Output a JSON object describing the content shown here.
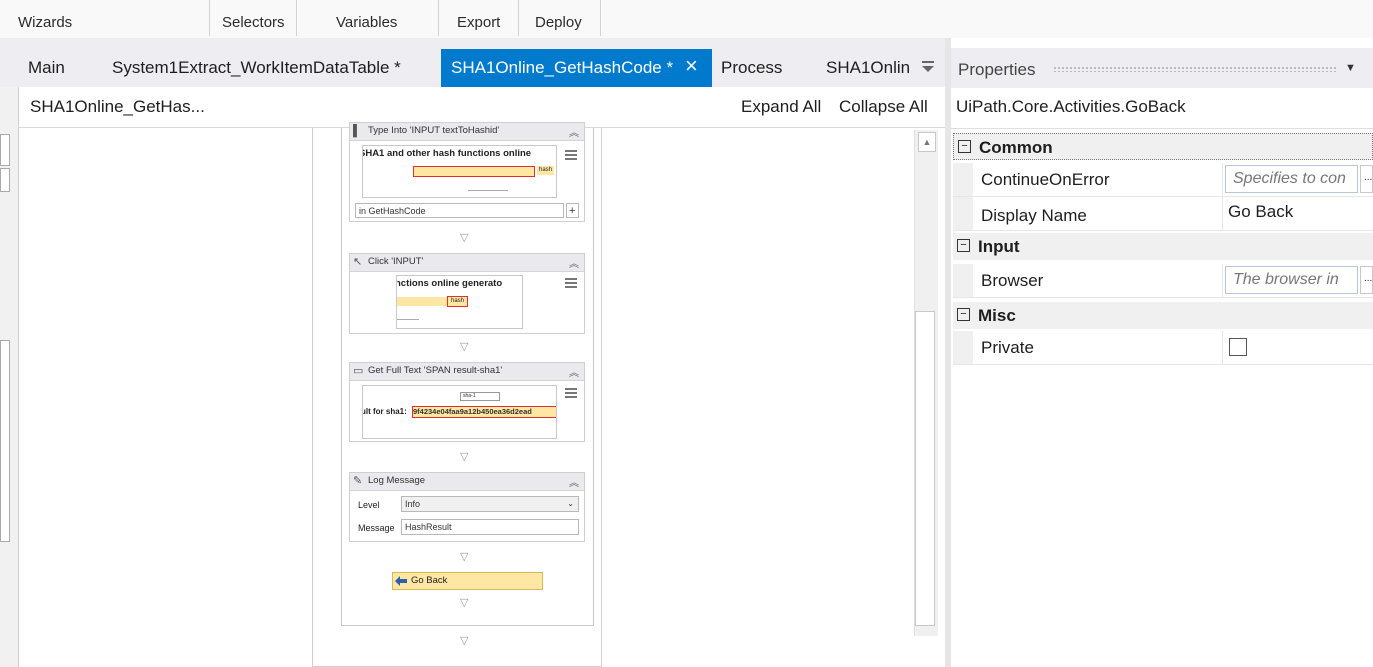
{
  "ribbon": {
    "groups": [
      "Wizards",
      "Selectors",
      "Variables",
      "Export",
      "Deploy"
    ]
  },
  "tabs": {
    "items": [
      "Main",
      "System1Extract_WorkItemDataTable *",
      "SHA1Online_GetHashCode *",
      "Process",
      "SHA1Onlin"
    ],
    "active_index": 2,
    "close_icon": "×"
  },
  "designer": {
    "breadcrumb": "SHA1Online_GetHas...",
    "expand_all": "Expand All",
    "collapse_all": "Collapse All"
  },
  "activities": {
    "type_into": {
      "title": "Type Into 'INPUT textToHashid'",
      "shot_text": "SHA1 and other hash functions online",
      "shot_button": "hash",
      "input_value": "in GetHashCode",
      "add_label": "+"
    },
    "click": {
      "title": "Click 'INPUT'",
      "shot_text": "nctions online generato",
      "shot_button": "hash"
    },
    "get_full_text": {
      "title": "Get Full Text 'SPAN  result-sha1'",
      "shot_select": "sha-1",
      "shot_label": "ult for sha1:",
      "shot_hash": "9f4234e04faa9a12b450ea36d2ead"
    },
    "log_message": {
      "title": "Log Message",
      "level_label": "Level",
      "level_value": "Info",
      "message_label": "Message",
      "message_value": "HashResult"
    },
    "go_back": {
      "title": "Go Back"
    }
  },
  "properties": {
    "title": "Properties",
    "activity_type": "UiPath.Core.Activities.GoBack",
    "categories": {
      "common": "Common",
      "input": "Input",
      "misc": "Misc"
    },
    "rows": {
      "continue_on_error": {
        "name": "ContinueOnError",
        "placeholder": "Specifies to con"
      },
      "display_name": {
        "name": "Display Name",
        "value": "Go Back"
      },
      "browser": {
        "name": "Browser",
        "placeholder": "The browser in"
      },
      "private": {
        "name": "Private",
        "checked": false
      }
    },
    "more_button": "..."
  },
  "colors": {
    "accent": "#007acc",
    "goback_fill": "#fde7a3",
    "highlight": "#e03030"
  }
}
